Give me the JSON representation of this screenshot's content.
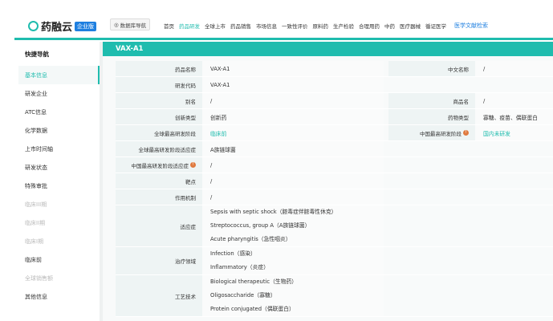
{
  "header": {
    "logo": "药融云",
    "edition_badge": "企业版",
    "db_nav": "数据库导航",
    "nav": [
      "首页",
      "药品研发",
      "全球上市",
      "药品销售",
      "市场信息",
      "一致性评价",
      "原料药",
      "生产检验",
      "合理用药",
      "中药",
      "医疗器械",
      "循证医学"
    ],
    "nav_active": 1,
    "literature": "医学文献检索"
  },
  "sidebar": {
    "title": "快捷导航",
    "items": [
      {
        "label": "基本信息",
        "state": "active"
      },
      {
        "label": "研发企业",
        "state": "normal"
      },
      {
        "label": "ATC信息",
        "state": "normal"
      },
      {
        "label": "化学数据",
        "state": "normal"
      },
      {
        "label": "上市时间轴",
        "state": "normal"
      },
      {
        "label": "研发状态",
        "state": "normal"
      },
      {
        "label": "特殊审批",
        "state": "normal"
      },
      {
        "label": "临床III期",
        "state": "dim"
      },
      {
        "label": "临床II期",
        "state": "dim"
      },
      {
        "label": "临床I期",
        "state": "dim"
      },
      {
        "label": "临床前",
        "state": "normal"
      },
      {
        "label": "全球销售额",
        "state": "dim"
      },
      {
        "label": "其他信息",
        "state": "normal"
      }
    ]
  },
  "main": {
    "title": "VAX-A1",
    "fields": {
      "drug_name": {
        "label": "药品名称",
        "value": "VAX-A1"
      },
      "cn_name": {
        "label": "中文名称",
        "value": "/"
      },
      "rd_code": {
        "label": "研发代码",
        "value": "VAX-A1"
      },
      "alias": {
        "label": "别名",
        "value": "/"
      },
      "trade_name": {
        "label": "商品名",
        "value": "/"
      },
      "innovation": {
        "label": "创新类型",
        "value": "创新药"
      },
      "drug_type": {
        "label": "药物类型",
        "value": "寡糖、疫苗、偶联蛋白"
      },
      "global_stage": {
        "label": "全球最高研发阶段",
        "value": "临床前"
      },
      "china_stage": {
        "label": "中国最高研发阶段",
        "value": "国内未研发"
      },
      "global_indication": {
        "label": "全球最高研发阶段适应症",
        "value": "A族链球菌"
      },
      "china_indication": {
        "label": "中国最高研发阶段适应症",
        "value": "/"
      },
      "target": {
        "label": "靶点",
        "value": "/"
      },
      "mechanism": {
        "label": "作用机制",
        "value": "/"
      },
      "indications": {
        "label": "适应症",
        "values": [
          "Sepsis with septic shock（脓毒症伴脓毒性休克）",
          "Streptococcus, group A（A族链球菌）",
          "Acute pharyngitis（急性咽炎）"
        ]
      },
      "therapeutic_area": {
        "label": "治疗领域",
        "values": [
          "Infection（感染）",
          "Inflammatory（炎症）"
        ]
      },
      "technology": {
        "label": "工艺技术",
        "values": [
          "Biological therapeutic（生物药）",
          "Oligosaccharide（寡糖）",
          "Protein conjugated（偶联蛋白）"
        ]
      }
    }
  }
}
